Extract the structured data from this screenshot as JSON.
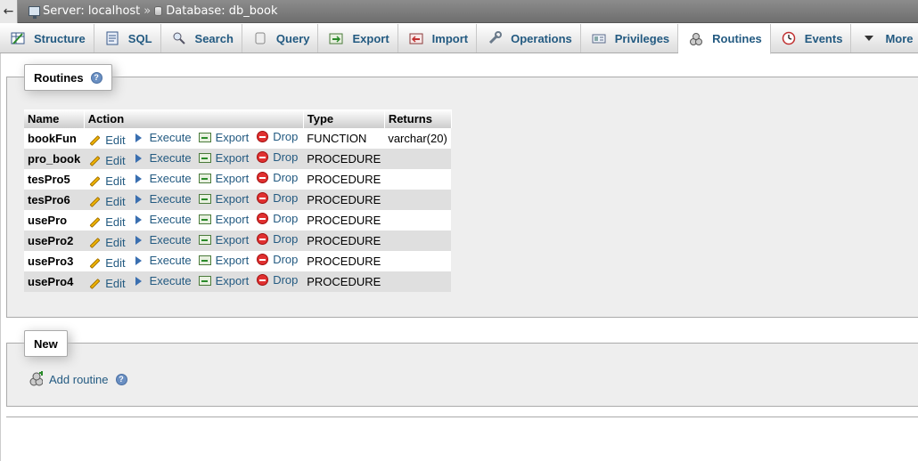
{
  "topbar": {
    "back_glyph": "←",
    "server_label": "Server: localhost",
    "separator": "»",
    "database_label": "Database: db_book"
  },
  "tabs": [
    {
      "label": "Structure",
      "icon": "structure-icon"
    },
    {
      "label": "SQL",
      "icon": "sql-icon"
    },
    {
      "label": "Search",
      "icon": "search-icon"
    },
    {
      "label": "Query",
      "icon": "query-icon"
    },
    {
      "label": "Export",
      "icon": "export-icon"
    },
    {
      "label": "Import",
      "icon": "import-icon"
    },
    {
      "label": "Operations",
      "icon": "wrench-icon"
    },
    {
      "label": "Privileges",
      "icon": "privileges-icon"
    },
    {
      "label": "Routines",
      "icon": "routines-icon",
      "active": true
    },
    {
      "label": "Events",
      "icon": "clock-icon"
    },
    {
      "label": "More",
      "icon": "triangle-down-icon"
    }
  ],
  "routines_section": {
    "title": "Routines",
    "help": "?",
    "columns": [
      "Name",
      "Action",
      "Type",
      "Returns"
    ],
    "actions": {
      "edit": "Edit",
      "execute": "Execute",
      "export": "Export",
      "drop": "Drop"
    },
    "rows": [
      {
        "name": "bookFun",
        "type": "FUNCTION",
        "returns": "varchar(20)"
      },
      {
        "name": "pro_book",
        "type": "PROCEDURE",
        "returns": ""
      },
      {
        "name": "tesPro5",
        "type": "PROCEDURE",
        "returns": ""
      },
      {
        "name": "tesPro6",
        "type": "PROCEDURE",
        "returns": ""
      },
      {
        "name": "usePro",
        "type": "PROCEDURE",
        "returns": ""
      },
      {
        "name": "usePro2",
        "type": "PROCEDURE",
        "returns": ""
      },
      {
        "name": "usePro3",
        "type": "PROCEDURE",
        "returns": ""
      },
      {
        "name": "usePro4",
        "type": "PROCEDURE",
        "returns": ""
      }
    ]
  },
  "new_section": {
    "title": "New",
    "add_routine_label": "Add routine",
    "help": "?"
  },
  "colors": {
    "link": "#235a81",
    "row_alt": "#dfdfdf",
    "fieldset_bg": "#eeeeee"
  }
}
